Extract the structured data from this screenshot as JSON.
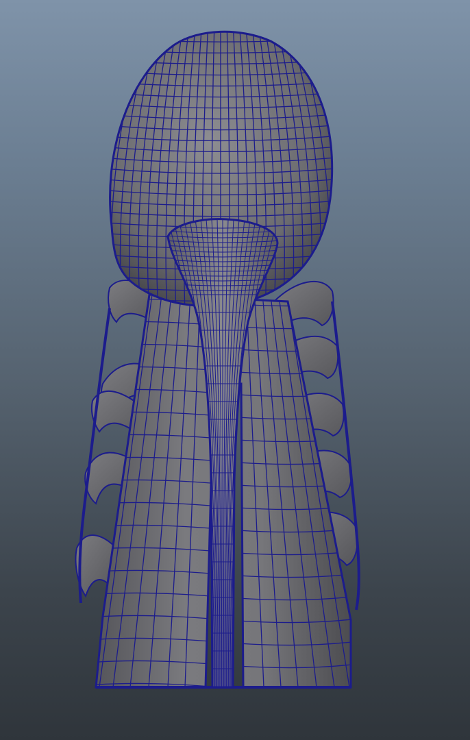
{
  "viewport": {
    "background_top": "#7f93a9",
    "background_bottom": "#2f353b",
    "wireframe_color": "#1c1c8c",
    "surface_color": "#6d6d70",
    "surface_shade": "#48484c",
    "surface_highlight": "#8a8a8e"
  },
  "model": {
    "description_icon": "high-heel-shoe-wireframe",
    "display_mode": "wireframe-on-shaded"
  }
}
